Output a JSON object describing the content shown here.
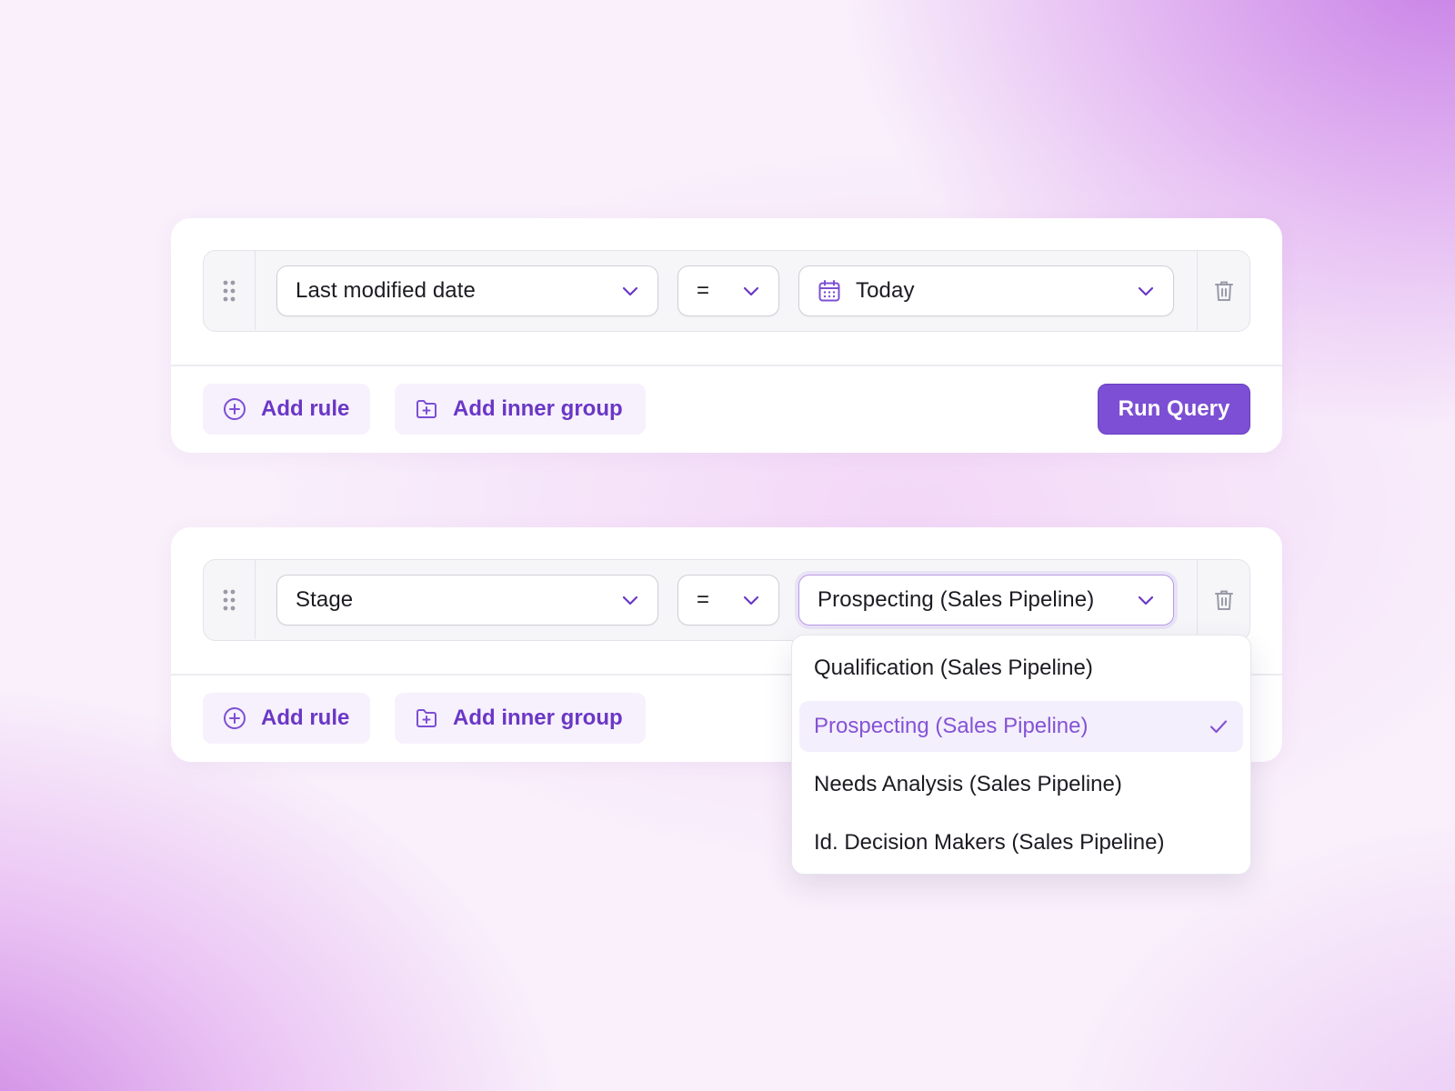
{
  "colors": {
    "accent": "#7c4fd4",
    "accent_text": "#6b37c5",
    "selected_text": "#8453d6",
    "text": "#1c1b22",
    "icon_gray": "#9a9aa8"
  },
  "query_groups": [
    {
      "rule": {
        "field": "Last modified date",
        "operator": "=",
        "value": "Today",
        "value_icon": "calendar-icon"
      },
      "actions": {
        "add_rule": "Add rule",
        "add_inner_group": "Add inner group",
        "run_query": "Run Query"
      }
    },
    {
      "rule": {
        "field": "Stage",
        "operator": "=",
        "value": "Prospecting (Sales Pipeline)"
      },
      "actions": {
        "add_rule": "Add rule",
        "add_inner_group": "Add inner group"
      }
    }
  ],
  "dropdown": {
    "options": [
      "Qualification (Sales Pipeline)",
      "Prospecting (Sales Pipeline)",
      "Needs Analysis (Sales Pipeline)",
      "Id. Decision Makers (Sales Pipeline)"
    ],
    "selected": "Prospecting (Sales Pipeline)"
  }
}
